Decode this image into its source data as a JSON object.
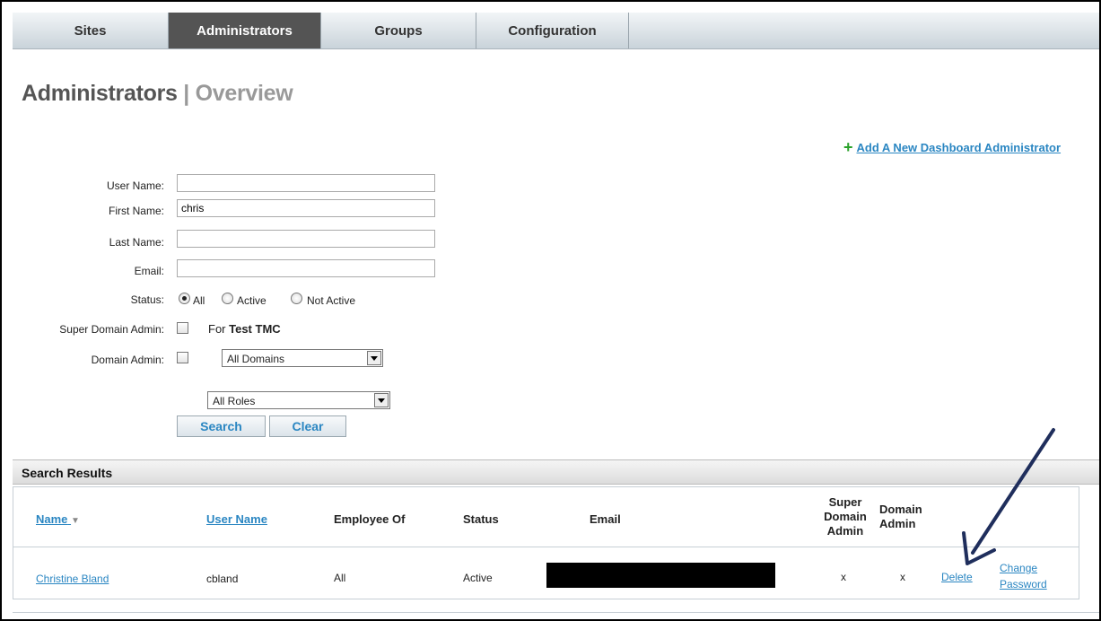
{
  "tabs": [
    {
      "label": "Sites"
    },
    {
      "label": "Administrators"
    },
    {
      "label": "Groups"
    },
    {
      "label": "Configuration"
    }
  ],
  "page": {
    "title": "Administrators",
    "separator": "|",
    "subtitle": "Overview"
  },
  "add_link": {
    "icon": "plus-icon",
    "label": "Add A New Dashboard Administrator"
  },
  "form": {
    "user_name_label": "User Name:",
    "user_name_value": "",
    "first_name_label": "First Name:",
    "first_name_value": "chris",
    "last_name_label": "Last Name:",
    "last_name_value": "",
    "email_label": "Email:",
    "email_value": "",
    "status_label": "Status:",
    "status_options": [
      "All",
      "Active",
      "Not Active"
    ],
    "status_selected": "All",
    "super_domain_label": "Super Domain Admin:",
    "super_domain_for": "For",
    "super_domain_tmc": "Test TMC",
    "domain_admin_label": "Domain Admin:",
    "domain_select": "All Domains",
    "roles_select": "All Roles",
    "search_label": "Search",
    "clear_label": "Clear"
  },
  "results": {
    "heading": "Search Results",
    "columns": {
      "name": "Name",
      "user_name": "User Name",
      "employee_of": "Employee Of",
      "status": "Status",
      "email": "Email",
      "super_domain_1": "Super",
      "super_domain_2": "Domain",
      "super_domain_3": "Admin",
      "domain_admin_1": "Domain",
      "domain_admin_2": "Admin"
    },
    "rows": [
      {
        "name": "Christine Bland",
        "user_name": "cbland",
        "employee_of": "All",
        "status": "Active",
        "super_domain": "x",
        "domain_admin": "x",
        "delete": "Delete",
        "change_1": "Change",
        "change_2": "Password"
      }
    ]
  },
  "colors": {
    "link": "#2a86c2",
    "active_tab": "#545454",
    "arrow": "#1f2e5c",
    "plus": "#2aa12a"
  }
}
